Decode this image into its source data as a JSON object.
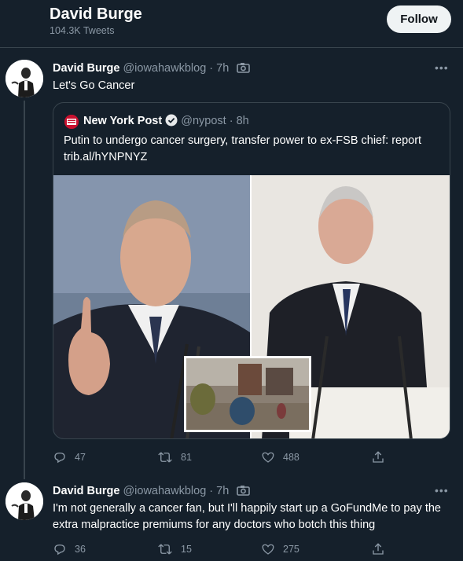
{
  "header": {
    "name": "David Burge",
    "tweet_count": "104.3K Tweets",
    "follow_label": "Follow"
  },
  "tweets": [
    {
      "author": "David Burge",
      "handle_time": "@iowahawkblog · 7h",
      "text": "Let's Go Cancer",
      "quote": {
        "author": "New York Post",
        "handle_time": "@nypost · 8h",
        "text": "Putin to undergo cancer surgery, transfer power to ex-FSB chief: report trib.al/hYNPNYZ",
        "avatar_text": "NEW YORK POST"
      },
      "replies": "47",
      "retweets": "81",
      "likes": "488"
    },
    {
      "author": "David Burge",
      "handle_time": "@iowahawkblog · 7h",
      "text": "I'm not generally a cancer fan, but I'll happily start up a GoFundMe to pay the extra malpractice premiums for any doctors who botch this thing",
      "replies": "36",
      "retweets": "15",
      "likes": "275"
    }
  ],
  "colors": {
    "background": "#15202b",
    "border": "#38444d",
    "muted": "#8b98a5",
    "verified": "#1d9bf0",
    "nypost_red": "#c8102e"
  }
}
